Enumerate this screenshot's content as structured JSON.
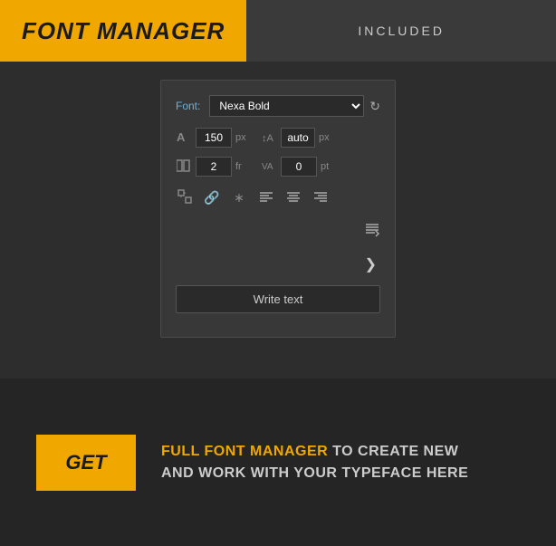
{
  "header": {
    "title": "FONT MANAGER",
    "badge": "INCLUDED"
  },
  "widget": {
    "font_label": "Font:",
    "font_name": "Nexa Bold",
    "size_value": "150",
    "size_unit": "px",
    "line_height_value": "auto",
    "line_height_unit": "px",
    "col_value": "2",
    "col_unit": "fr",
    "tracking_value": "0",
    "tracking_unit": "pt",
    "write_text_label": "Write text"
  },
  "bottom": {
    "get_label": "GET",
    "description_highlight": "FULL FONT MANAGER",
    "description_rest": " TO CREATE NEW\nAND WORK WITH YOUR TYPEFACE HERE"
  }
}
